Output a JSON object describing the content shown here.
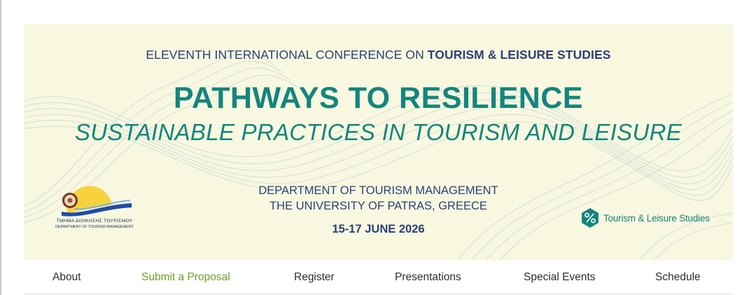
{
  "banner": {
    "conference_prefix": "ELEVENTH INTERNATIONAL CONFERENCE ON ",
    "conference_bold": "TOURISM & LEISURE STUDIES",
    "title": "PATHWAYS TO RESILIENCE",
    "subtitle": "SUSTAINABLE PRACTICES IN TOURISM AND LEISURE",
    "department": "DEPARTMENT OF TOURISM MANAGEMENT",
    "university": "THE UNIVERSITY OF PATRAS,  GREECE",
    "dates": "15-17 JUNE 2026",
    "dept_logo": {
      "greek_text": "ΤΜΗΜΑ ΔΙΟΙΚΗΣΗΣ ΤΟΥΡΙΣΜΟΥ",
      "english_text": "DEPARTMENT OF TOURISM MANAGEMENT",
      "icon": "sun-wave-emblem-icon"
    },
    "brand_logo": {
      "text": "Tourism & Leisure Studies",
      "icon": "hexagon-percent-icon"
    }
  },
  "nav": {
    "items": [
      {
        "label": "About",
        "active": false
      },
      {
        "label": "Submit a Proposal",
        "active": true
      },
      {
        "label": "Register",
        "active": false
      },
      {
        "label": "Presentations",
        "active": false
      },
      {
        "label": "Special Events",
        "active": false
      },
      {
        "label": "Schedule",
        "active": false
      }
    ]
  },
  "colors": {
    "banner_bg": "#f8f7df",
    "teal": "#13857e",
    "navy": "#2c4178",
    "nav_active": "#6f9e28",
    "nav_text": "#2e2e2e",
    "wave_blue": "#9cc3d3",
    "sun_yellow": "#f6d33c"
  }
}
